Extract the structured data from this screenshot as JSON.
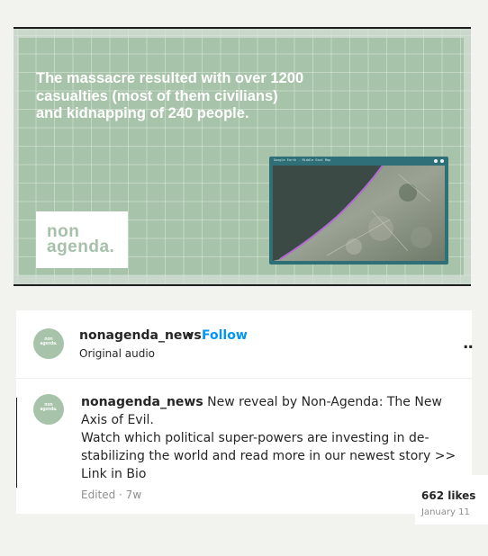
{
  "video": {
    "headline": "The  massacre resulted with  over 1200\ncasualties (most of them civilians)\nand kidnapping of 240 people.",
    "logo_text": "non\nagenda.",
    "map_window_title": "Google Earth - Middle East Map"
  },
  "post": {
    "avatar_text": "non\nagenda.",
    "username": "nonagenda_news",
    "separator": "•",
    "follow_label": "Follow",
    "audio_label": "Original audio",
    "more_label": "..",
    "caption_username": "nonagenda_news",
    "caption_text": " New reveal by Non-Agenda: The New Axis of Evil.\nWatch which political super-powers are investing in de-stabilizing the world and read more in our newest story >> Link in Bio",
    "edited_label": "Edited · 7w",
    "likes": "662 likes",
    "date": "January 11"
  },
  "colors": {
    "slide_green": "#a7c3a9",
    "follow_blue": "#0095f6",
    "map_frame": "#2f6f77"
  }
}
